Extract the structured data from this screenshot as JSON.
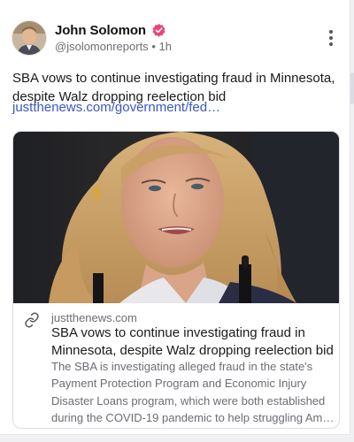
{
  "author": {
    "name": "John Solomon",
    "handle": "@jsolomonreports",
    "separator": "•",
    "time": "1h",
    "verified_color": "#e8457a"
  },
  "post": {
    "text": "SBA vows to continue investigating fraud in Minnesota, despite Walz dropping reelection bid",
    "link_text": "justthenews.com/government/fed…"
  },
  "card": {
    "domain": "justthenews.com",
    "title": "SBA vows to continue investigating fraud in Minnesota, despite Walz dropping reelection bid",
    "description": "The SBA is investigating alleged fraud in the state's Payment Protection Program and Economic Injury Disaster Loans program, which were both established during the COVID-19 pandemic to help struggling Am…"
  },
  "icons": {
    "verified": "verified-badge-icon",
    "more": "more-vertical-icon",
    "link": "link-icon"
  },
  "colors": {
    "link": "#3b55c9",
    "secondary_text": "#6c6c75",
    "accent": "#e8457a"
  }
}
